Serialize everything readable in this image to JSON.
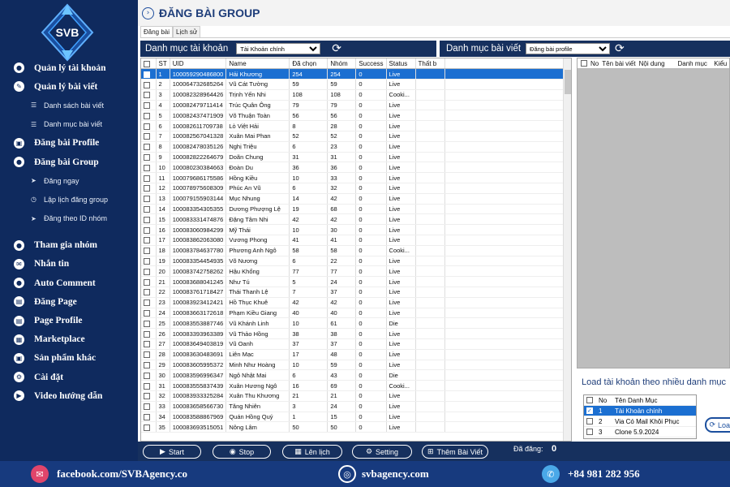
{
  "app": {
    "logo_text": "SVB",
    "title": "ĐĂNG BÀI GROUP"
  },
  "sidebar": {
    "items": [
      {
        "type": "main",
        "label": "Quản lý tài khoản",
        "icon": "user-icon",
        "glyph": "●"
      },
      {
        "type": "main",
        "label": "Quản lý bài viết",
        "icon": "pencil-icon",
        "glyph": "✎"
      },
      {
        "type": "sub",
        "label": "Danh sách bài viết",
        "icon": "list-icon",
        "glyph": "☰"
      },
      {
        "type": "sub",
        "label": "Danh mục bài viết",
        "icon": "category-list-icon",
        "glyph": "☰"
      },
      {
        "type": "main",
        "label": "Đăng bài Profile",
        "icon": "profile-icon",
        "glyph": "▣"
      },
      {
        "type": "main",
        "label": "Đăng bài Group",
        "icon": "group-icon",
        "glyph": "●"
      },
      {
        "type": "sub",
        "label": "Đăng ngay",
        "icon": "send-icon",
        "glyph": "➤"
      },
      {
        "type": "sub",
        "label": "Lập lịch đăng group",
        "icon": "clock-icon",
        "glyph": "◷"
      },
      {
        "type": "sub",
        "label": "Đăng theo ID nhóm",
        "icon": "send-icon",
        "glyph": "➤"
      },
      {
        "type": "gap"
      },
      {
        "type": "main",
        "label": "Tham gia nhóm",
        "icon": "join-group-icon",
        "glyph": "●"
      },
      {
        "type": "main",
        "label": "Nhắn tin",
        "icon": "message-icon",
        "glyph": "✉"
      },
      {
        "type": "main",
        "label": "Auto Comment",
        "icon": "comment-icon",
        "glyph": "●"
      },
      {
        "type": "main",
        "label": "Đăng Page",
        "icon": "page-icon",
        "glyph": "▤"
      },
      {
        "type": "main",
        "label": "Page Profile",
        "icon": "page-profile-icon",
        "glyph": "▤"
      },
      {
        "type": "main",
        "label": "Marketplace",
        "icon": "marketplace-icon",
        "glyph": "▦"
      },
      {
        "type": "main",
        "label": "Sản phẩm khác",
        "icon": "products-icon",
        "glyph": "▣"
      },
      {
        "type": "main",
        "label": "Cài đặt",
        "icon": "gear-icon",
        "glyph": "⚙"
      },
      {
        "type": "main",
        "label": "Video hướng dẫn",
        "icon": "video-icon",
        "glyph": "▶"
      }
    ]
  },
  "tabs": [
    "Đăng bài",
    "Lịch sử"
  ],
  "left_panel": {
    "title": "Danh mục tài khoản",
    "select": "Tài Khoản chính"
  },
  "right_panel": {
    "title": "Danh mục bài viết",
    "select": "Đăng bài profile"
  },
  "accounts": {
    "columns": [
      "ST",
      "UID",
      "Name",
      "Đã chọn",
      "Nhóm",
      "Success",
      "Status",
      "Thất b"
    ],
    "rows": [
      [
        "1",
        "100059290486800",
        "Hải Khương",
        "254",
        "254",
        "0",
        "Live"
      ],
      [
        "2",
        "100064732685264",
        "Vũ Cát Tường",
        "59",
        "59",
        "0",
        "Live"
      ],
      [
        "3",
        "100082328964426",
        "Trịnh Yến Nhi",
        "108",
        "108",
        "0",
        "Cooki..."
      ],
      [
        "4",
        "100082479711414",
        "Trúc Quân Ông",
        "79",
        "79",
        "0",
        "Live"
      ],
      [
        "5",
        "100082437471909",
        "Võ Thuận Toàn",
        "56",
        "56",
        "0",
        "Live"
      ],
      [
        "6",
        "100082611709738",
        "Lò Việt Hải",
        "8",
        "28",
        "0",
        "Live"
      ],
      [
        "7",
        "100082567041328",
        "Xuân Mai Phan",
        "52",
        "52",
        "0",
        "Live"
      ],
      [
        "8",
        "100082478035126",
        "Nghị Triệu",
        "6",
        "23",
        "0",
        "Live"
      ],
      [
        "9",
        "100082822264679",
        "Doãn Chung",
        "31",
        "31",
        "0",
        "Live"
      ],
      [
        "10",
        "100080230384663",
        "Đoàn Du",
        "36",
        "36",
        "0",
        "Live"
      ],
      [
        "11",
        "100079686175586",
        "Hồng Kiều",
        "10",
        "33",
        "0",
        "Live"
      ],
      [
        "12",
        "100078975608309",
        "Phúc An Vũ",
        "6",
        "32",
        "0",
        "Live"
      ],
      [
        "13",
        "100079155903144",
        "Mục Nhung",
        "14",
        "42",
        "0",
        "Live"
      ],
      [
        "14",
        "100083354305355",
        "Dương Phượng Lệ",
        "19",
        "68",
        "0",
        "Live"
      ],
      [
        "15",
        "100083331474876",
        "Đặng Tâm Nhi",
        "42",
        "42",
        "0",
        "Live"
      ],
      [
        "16",
        "100083060984299",
        "Mỹ Thái",
        "10",
        "30",
        "0",
        "Live"
      ],
      [
        "17",
        "100083862063080",
        "Vương Phong",
        "41",
        "41",
        "0",
        "Live"
      ],
      [
        "18",
        "100083784637780",
        "Phương Anh Ngô",
        "58",
        "58",
        "0",
        "Cooki..."
      ],
      [
        "19",
        "100083354454935",
        "Võ Nương",
        "6",
        "22",
        "0",
        "Live"
      ],
      [
        "20",
        "100083742758262",
        "Hậu Khổng",
        "77",
        "77",
        "0",
        "Live"
      ],
      [
        "21",
        "100083688041245",
        "Như Tú",
        "5",
        "24",
        "0",
        "Live"
      ],
      [
        "22",
        "100083761718427",
        "Thái Thanh Lệ",
        "7",
        "37",
        "0",
        "Live"
      ],
      [
        "23",
        "100083923412421",
        "Hồ Thục Khuê",
        "42",
        "42",
        "0",
        "Live"
      ],
      [
        "24",
        "100083663172618",
        "Phạm Kiều Giang",
        "40",
        "40",
        "0",
        "Live"
      ],
      [
        "25",
        "100083553887746",
        "Vũ Khánh Linh",
        "10",
        "61",
        "0",
        "Die"
      ],
      [
        "26",
        "100083393963389",
        "Vũ Thảo Hồng",
        "38",
        "38",
        "0",
        "Live"
      ],
      [
        "27",
        "100083649403819",
        "Vũ Oanh",
        "37",
        "37",
        "0",
        "Live"
      ],
      [
        "28",
        "100083630483691",
        "Liên Mạc",
        "17",
        "48",
        "0",
        "Live"
      ],
      [
        "29",
        "100083605995372",
        "Minh Như Hoàng",
        "10",
        "59",
        "0",
        "Live"
      ],
      [
        "30",
        "100083596996347",
        "Ngô Nhật Mai",
        "6",
        "43",
        "0",
        "Die"
      ],
      [
        "31",
        "100083555837439",
        "Xuân Hương Ngô",
        "16",
        "69",
        "0",
        "Cooki..."
      ],
      [
        "32",
        "100083933325284",
        "Xuân Thu Khương",
        "21",
        "21",
        "0",
        "Live"
      ],
      [
        "33",
        "100083658566730",
        "Tăng Nhiên",
        "3",
        "24",
        "0",
        "Live"
      ],
      [
        "34",
        "100083588867969",
        "Quán Hồng Quý",
        "1",
        "15",
        "0",
        "Live"
      ],
      [
        "35",
        "100083693515051",
        "Nông Lâm",
        "50",
        "50",
        "0",
        "Live"
      ]
    ]
  },
  "posts": {
    "columns": [
      "No",
      "Tên bài viết",
      "Nội dung",
      "Danh mục",
      "Kiểu"
    ]
  },
  "load": {
    "title": "Load tài khoản theo nhiều danh mục",
    "columns": [
      "No",
      "Tên Danh Mục"
    ],
    "rows": [
      [
        "1",
        "Tài Khoản chính"
      ],
      [
        "2",
        "Via Có Mail Khôi Phục"
      ],
      [
        "3",
        "Clone 5.9.2024"
      ]
    ],
    "button": "Load nhiều"
  },
  "actions": {
    "start": "Start",
    "stop": "Stop",
    "schedule": "Lên lịch",
    "setting": "Setting",
    "add_post": "Thêm Bài Viết",
    "posted_label": "Đã đăng:",
    "posted_value": "0"
  },
  "footer": {
    "facebook": "facebook.com/SVBAgency.co",
    "website": "svbagency.com",
    "phone": "+84 981 282 956"
  },
  "colors": {
    "sidebar": "#0f2a5e",
    "panel": "#16305e",
    "selected": "#1b6fd1",
    "footer": "#173a7e",
    "accent_red": "#e0456b"
  }
}
